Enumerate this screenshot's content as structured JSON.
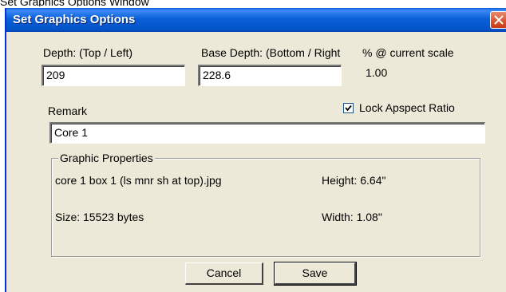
{
  "caption_above": "Set Graphics Options Window",
  "window": {
    "title": "Set Graphics Options"
  },
  "fields": {
    "depth_top_label": "Depth: (Top / Left)",
    "depth_top_value": "209",
    "base_depth_label": "Base Depth: (Bottom / Right",
    "base_depth_value": "228.6",
    "scale_label": "% @ current scale",
    "scale_value": "1.00",
    "remark_label": "Remark",
    "remark_value": "Core 1",
    "lock_aspect_label": "Lock Apspect Ratio",
    "lock_aspect_checked": true
  },
  "graphic_properties": {
    "legend": "Graphic Properties",
    "filename": "core 1 box 1 (ls mnr sh at top).jpg",
    "height": "Height: 6.64\"",
    "size": "Size: 15523 bytes",
    "width": "Width: 1.08\""
  },
  "buttons": {
    "cancel": "Cancel",
    "save": "Save"
  }
}
